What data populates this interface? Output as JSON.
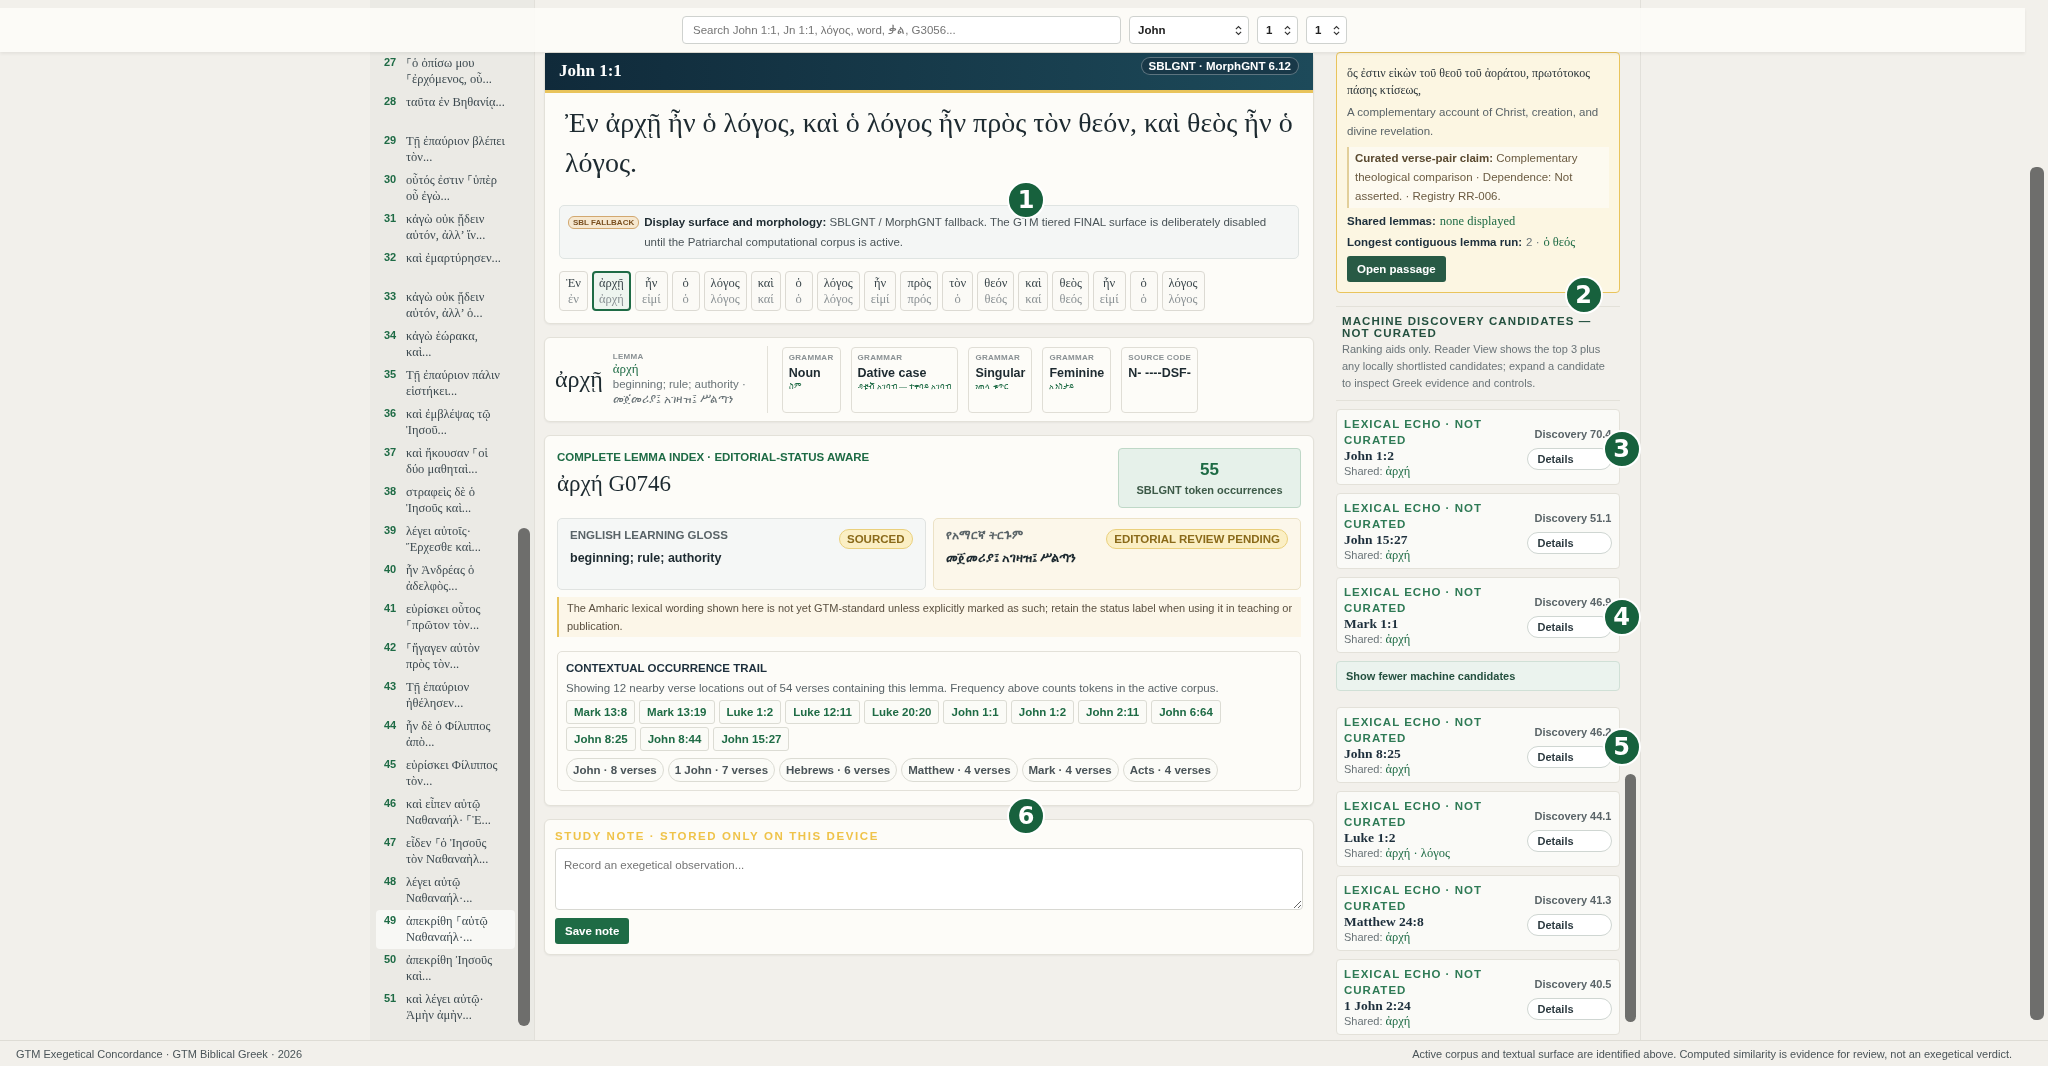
{
  "search": {
    "placeholder": "Search John 1:1, Jn 1:1, λόγος, word, ቃል, G3056..."
  },
  "selectors": [
    {
      "value": "John"
    },
    {
      "value": "1"
    },
    {
      "value": "1"
    }
  ],
  "verse_list": [
    {
      "number": "27",
      "text": "⸀ὁ ὀπίσω μου ⸀ἐρχόμενος, οὗ...",
      "selected": false
    },
    {
      "number": "28",
      "text": "ταῦτα ἐν Βηθανίᾳ...",
      "selected": false
    },
    {
      "number": "29",
      "text": "Τῇ ἐπαύριον βλέπει τὸν...",
      "selected": false
    },
    {
      "number": "30",
      "text": "οὗτός ἐστιν ⸀ὑπὲρ οὗ ἐγὼ...",
      "selected": false
    },
    {
      "number": "31",
      "text": "κἀγὼ οὐκ ᾔδειν αὐτόν, ἀλλ’ ἵν...",
      "selected": false
    },
    {
      "number": "32",
      "text": "καὶ ἐμαρτύρησεν...",
      "selected": false
    },
    {
      "number": "33",
      "text": "κἀγὼ οὐκ ᾔδειν αὐτόν, ἀλλ’ ὁ...",
      "selected": false
    },
    {
      "number": "34",
      "text": "κἀγὼ ἑώρακα, καὶ...",
      "selected": false
    },
    {
      "number": "35",
      "text": "Τῇ ἐπαύριον πάλιν εἱστήκει...",
      "selected": false
    },
    {
      "number": "36",
      "text": "καὶ ἐμβλέψας τῷ Ἰησοῦ...",
      "selected": false
    },
    {
      "number": "37",
      "text": "καὶ ἤκουσαν ⸀οἱ δύο μαθηταὶ...",
      "selected": false
    },
    {
      "number": "38",
      "text": "στραφεὶς δὲ ὁ Ἰησοῦς καὶ...",
      "selected": false
    },
    {
      "number": "39",
      "text": "λέγει αὐτοῖς· Ἔρχεσθε καὶ...",
      "selected": false
    },
    {
      "number": "40",
      "text": "ἦν Ἀνδρέας ὁ ἀδελφὸς...",
      "selected": false
    },
    {
      "number": "41",
      "text": "εὑρίσκει οὗτος ⸀πρῶτον τὸν...",
      "selected": false
    },
    {
      "number": "42",
      "text": "⸀ἤγαγεν αὐτὸν πρὸς τὸν...",
      "selected": false
    },
    {
      "number": "43",
      "text": "Τῇ ἐπαύριον ἠθέλησεν...",
      "selected": false
    },
    {
      "number": "44",
      "text": "ἦν δὲ ὁ Φίλιππος ἀπὸ...",
      "selected": false
    },
    {
      "number": "45",
      "text": "εὑρίσκει Φίλιππος τὸν...",
      "selected": false
    },
    {
      "number": "46",
      "text": "καὶ εἶπεν αὐτῷ Ναθαναήλ· ⸀Ἐ...",
      "selected": false
    },
    {
      "number": "47",
      "text": "εἶδεν ⸀ὁ Ἰησοῦς τὸν Ναθαναὴλ...",
      "selected": false
    },
    {
      "number": "48",
      "text": "λέγει αὐτῷ Ναθαναήλ·...",
      "selected": false
    },
    {
      "number": "49",
      "text": "ἀπεκρίθη ⸀αὐτῷ Ναθαναήλ·...",
      "selected": true
    },
    {
      "number": "50",
      "text": "ἀπεκρίθη Ἰησοῦς καὶ...",
      "selected": false
    },
    {
      "number": "51",
      "text": "καὶ λέγει αὐτῷ· Ἀμὴν ἀμὴν...",
      "selected": false
    }
  ],
  "passage": {
    "reference": "John 1:1",
    "edition": "SBLGNT · MorphGNT 6.12",
    "text": "Ἐν ἀρχῇ ἦν ὁ λόγος, καὶ ὁ λόγος ἦν πρὸς τὸν θεόν, καὶ θεὸς ἦν ὁ λόγος.",
    "callout": "1",
    "surface_note": {
      "badge": "SBL FALLBACK",
      "text": "**Display surface and morphology:** SBLGNT / MorphGNT fallback. The GTM tiered FINAL surface is deliberately disabled until the Patriarchal computational corpus is active."
    },
    "tokens": [
      {
        "surface": "Ἐν",
        "lemma": "ἐν",
        "selected": false
      },
      {
        "surface": "ἀρχῇ",
        "lemma": "ἀρχή",
        "selected": true
      },
      {
        "surface": "ἦν",
        "lemma": "εἰμί",
        "selected": false
      },
      {
        "surface": "ὁ",
        "lemma": "ὁ",
        "selected": false
      },
      {
        "surface": "λόγος",
        "lemma": "λόγος",
        "selected": false
      },
      {
        "surface": "καὶ",
        "lemma": "καί",
        "selected": false
      },
      {
        "surface": "ὁ",
        "lemma": "ὁ",
        "selected": false
      },
      {
        "surface": "λόγος",
        "lemma": "λόγος",
        "selected": false
      },
      {
        "surface": "ἦν",
        "lemma": "εἰμί",
        "selected": false
      },
      {
        "surface": "πρὸς",
        "lemma": "πρός",
        "selected": false
      },
      {
        "surface": "τὸν",
        "lemma": "ὁ",
        "selected": false
      },
      {
        "surface": "θεόν",
        "lemma": "θεός",
        "selected": false
      },
      {
        "surface": "καὶ",
        "lemma": "καί",
        "selected": false
      },
      {
        "surface": "θεὸς",
        "lemma": "θεός",
        "selected": false
      },
      {
        "surface": "ἦν",
        "lemma": "εἰμί",
        "selected": false
      },
      {
        "surface": "ὁ",
        "lemma": "ὁ",
        "selected": false
      },
      {
        "surface": "λόγος",
        "lemma": "λόγος",
        "selected": false
      }
    ]
  },
  "morphology": {
    "form": "ἀρχῇ",
    "lemma_label": "LEMMA",
    "lemma": "ἀρχή",
    "gloss": "beginning; rule; authority · መጀመሪያ፤ አገዛዝ፤ ሥልጣን",
    "features": [
      {
        "label": "GRAMMAR",
        "value": "Noun",
        "sub": "ስም"
      },
      {
        "label": "GRAMMAR",
        "value": "Dative case",
        "sub": "ዳቲቭ አገባብ — ተቀባይ አገባብ"
      },
      {
        "label": "GRAMMAR",
        "value": "Singular",
        "sub": "ነጠላ ቁጥር"
      },
      {
        "label": "GRAMMAR",
        "value": "Feminine",
        "sub": "አንስታይ"
      },
      {
        "label": "SOURCE CODE",
        "value": "N- ----DSF-"
      }
    ]
  },
  "lemma_index": {
    "eyebrow": "COMPLETE LEMMA INDEX · EDITORIAL-STATUS AWARE",
    "title": "ἀρχή G0746",
    "count": "55",
    "count_label": "SBLGNT token occurrences",
    "callout": "6",
    "glosses": [
      {
        "label": "ENGLISH LEARNING GLOSS",
        "status": "SOURCED",
        "text": "beginning; rule; authority",
        "kind": "english"
      },
      {
        "label": "የአማርኛ ትርጉም",
        "status": "EDITORIAL REVIEW PENDING",
        "text": "መጀመሪያ፤ አገዛዝ፤ ሥልጣን",
        "kind": "amharic"
      }
    ],
    "warning": "The Amharic lexical wording shown here is not yet GTM-standard unless explicitly marked as such; retain the status label when using it in teaching or publication.",
    "trail": {
      "title": "CONTEXTUAL OCCURRENCE TRAIL",
      "description": "Showing 12 nearby verse locations out of 54 verses containing this lemma. Frequency above counts tokens in the active corpus.",
      "references": [
        "Mark 13:8",
        "Mark 13:19",
        "Luke 1:2",
        "Luke 12:11",
        "Luke 20:20",
        "John 1:1",
        "John 1:2",
        "John 2:11",
        "John 6:64",
        "John 8:25",
        "John 8:44",
        "John 15:27"
      ],
      "books": [
        "John · 8 verses",
        "1 John · 7 verses",
        "Hebrews · 6 verses",
        "Matthew · 4 verses",
        "Mark · 4 verses",
        "Acts · 4 verses"
      ]
    }
  },
  "study_note": {
    "label": "STUDY NOTE · STORED ONLY ON THIS DEVICE",
    "placeholder": "Record an exegetical observation...",
    "button": "Save note"
  },
  "curated_pair": {
    "greek": "ὅς ἐστιν εἰκὼν τοῦ θεοῦ τοῦ ἀοράτου, πρωτότοκος πάσης κτίσεως,",
    "summary": "A complementary account of Christ, creation, and divine revelation.",
    "claim": "**Curated verse-pair claim:** Complementary theological comparison · Dependence: Not asserted. · Registry RR-006.",
    "shared_label": "Shared lemmas:",
    "shared": "none displayed",
    "run_label": "Longest contiguous lemma run:",
    "run_count": "2 ·",
    "run_lemmas": "ὁ θεός",
    "button": "Open passage",
    "callout": "2"
  },
  "discovery": {
    "title": "MACHINE DISCOVERY CANDIDATES — NOT CURATED",
    "description": "Ranking aids only. Reader View shows the top 3 plus any locally shortlisted candidates; expand a candidate to inspect Greek evidence and controls.",
    "items": [
      {
        "kind": "candidate",
        "label": "LEXICAL ECHO · NOT CURATED",
        "reference": "John 1:2",
        "shared_label": "Shared:",
        "shared": "ἀρχή",
        "score": "Discovery 70.4",
        "button": "Details",
        "callout": "3"
      },
      {
        "kind": "candidate",
        "label": "LEXICAL ECHO · NOT CURATED",
        "reference": "John 15:27",
        "shared_label": "Shared:",
        "shared": "ἀρχή",
        "score": "Discovery 51.1",
        "button": "Details"
      },
      {
        "kind": "candidate",
        "label": "LEXICAL ECHO · NOT CURATED",
        "reference": "Mark 1:1",
        "shared_label": "Shared:",
        "shared": "ἀρχή",
        "score": "Discovery 46.9",
        "button": "Details",
        "callout": "4"
      },
      {
        "kind": "toggle",
        "label": "Show fewer machine candidates"
      },
      {
        "kind": "candidate",
        "label": "LEXICAL ECHO · NOT CURATED",
        "reference": "John 8:25",
        "shared_label": "Shared:",
        "shared": "ἀρχή",
        "score": "Discovery 46.2",
        "button": "Details",
        "callout": "5"
      },
      {
        "kind": "candidate",
        "label": "LEXICAL ECHO · NOT CURATED",
        "reference": "Luke 1:2",
        "shared_label": "Shared:",
        "shared": "ἀρχή · λόγος",
        "score": "Discovery 44.1",
        "button": "Details"
      },
      {
        "kind": "candidate",
        "label": "LEXICAL ECHO · NOT CURATED",
        "reference": "Matthew 24:8",
        "shared_label": "Shared:",
        "shared": "ἀρχή",
        "score": "Discovery 41.3",
        "button": "Details"
      },
      {
        "kind": "candidate",
        "label": "LEXICAL ECHO · NOT CURATED",
        "reference": "1 John 2:24",
        "shared_label": "Shared:",
        "shared": "ἀρχή",
        "score": "Discovery 40.5",
        "button": "Details"
      }
    ]
  },
  "footer": {
    "left": "GTM Exegetical Concordance · GTM Biblical Greek · 2026",
    "right": "Active corpus and textual surface are identified above. Computed similarity is evidence for review, not an exegetical verdict."
  }
}
